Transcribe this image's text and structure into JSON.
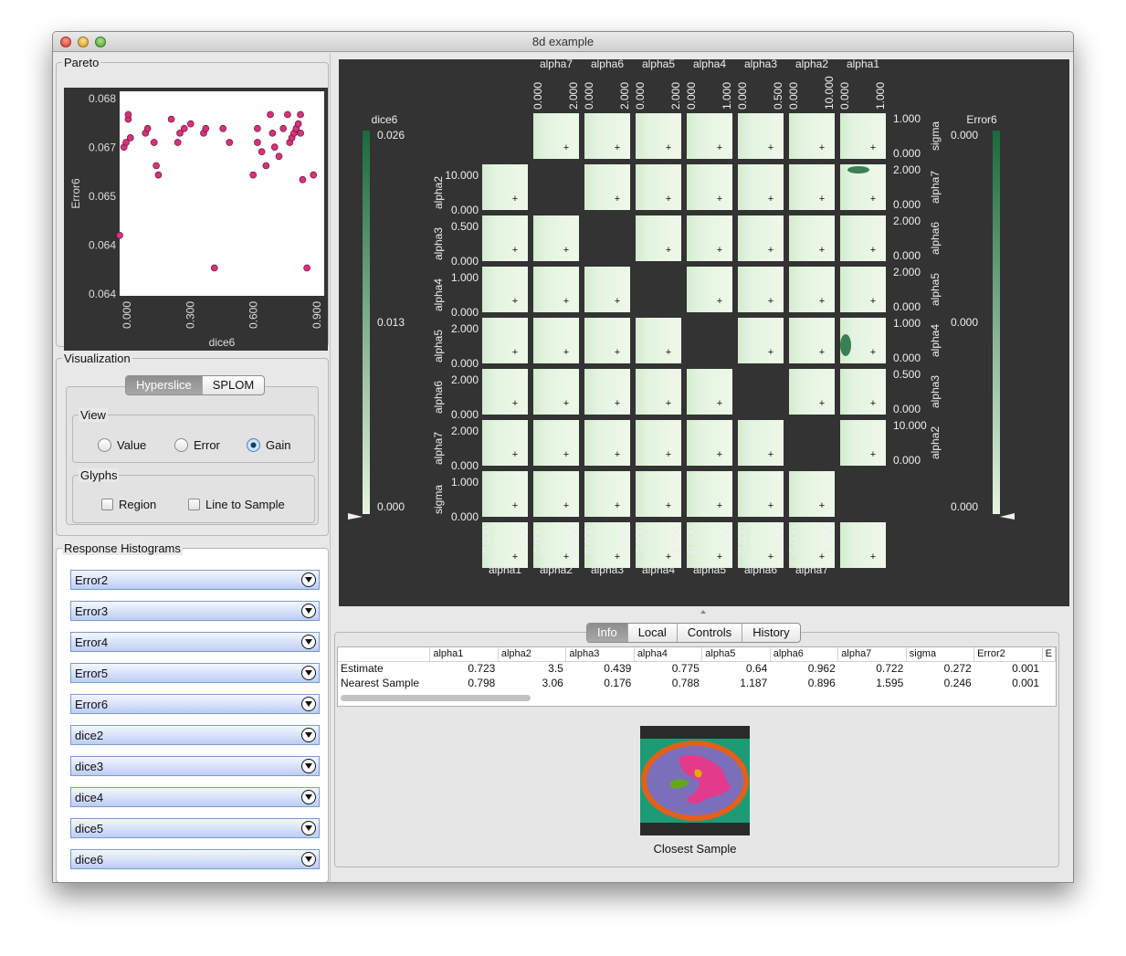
{
  "window": {
    "title": "8d example"
  },
  "pareto": {
    "title": "Pareto",
    "xlabel": "dice6",
    "ylabel": "Error6",
    "xticks": [
      "0.000",
      "0.300",
      "0.600",
      "0.900"
    ],
    "yticks": [
      "0.068",
      "0.067",
      "0.065",
      "0.064",
      "0.064"
    ],
    "point_color": "#d6337a",
    "xlim": [
      0.0,
      0.95
    ],
    "ylim": [
      0.0637,
      0.0681
    ],
    "points": [
      [
        0.0,
        0.065
      ],
      [
        0.02,
        0.0669
      ],
      [
        0.03,
        0.067
      ],
      [
        0.04,
        0.0675
      ],
      [
        0.04,
        0.0676
      ],
      [
        0.05,
        0.0671
      ],
      [
        0.12,
        0.0672
      ],
      [
        0.13,
        0.0673
      ],
      [
        0.16,
        0.067
      ],
      [
        0.17,
        0.0665
      ],
      [
        0.18,
        0.0663
      ],
      [
        0.24,
        0.0675
      ],
      [
        0.27,
        0.067
      ],
      [
        0.28,
        0.0672
      ],
      [
        0.3,
        0.0673
      ],
      [
        0.33,
        0.0674
      ],
      [
        0.39,
        0.0672
      ],
      [
        0.4,
        0.0673
      ],
      [
        0.44,
        0.0643
      ],
      [
        0.48,
        0.0673
      ],
      [
        0.51,
        0.067
      ],
      [
        0.62,
        0.0663
      ],
      [
        0.64,
        0.0673
      ],
      [
        0.64,
        0.067
      ],
      [
        0.66,
        0.0668
      ],
      [
        0.68,
        0.0665
      ],
      [
        0.7,
        0.0676
      ],
      [
        0.71,
        0.0672
      ],
      [
        0.72,
        0.0669
      ],
      [
        0.74,
        0.0667
      ],
      [
        0.76,
        0.0673
      ],
      [
        0.78,
        0.0676
      ],
      [
        0.79,
        0.067
      ],
      [
        0.8,
        0.0671
      ],
      [
        0.81,
        0.0672
      ],
      [
        0.82,
        0.0673
      ],
      [
        0.83,
        0.0674
      ],
      [
        0.84,
        0.0676
      ],
      [
        0.84,
        0.0672
      ],
      [
        0.85,
        0.0662
      ],
      [
        0.87,
        0.0643
      ],
      [
        0.9,
        0.0663
      ]
    ]
  },
  "visualization": {
    "title": "Visualization",
    "mode_tabs": [
      "Hyperslice",
      "SPLOM"
    ],
    "active_mode": "Hyperslice",
    "view": {
      "title": "View",
      "options": [
        "Value",
        "Error",
        "Gain"
      ],
      "selected": "Gain"
    },
    "glyphs": {
      "title": "Glyphs",
      "options": [
        "Region",
        "Line to Sample"
      ]
    }
  },
  "histograms": {
    "title": "Response Histograms",
    "items": [
      "Error2",
      "Error3",
      "Error4",
      "Error5",
      "Error6",
      "dice2",
      "dice3",
      "dice4",
      "dice5",
      "dice6"
    ]
  },
  "matrix": {
    "lower_dims": [
      "alpha2",
      "alpha3",
      "alpha4",
      "alpha5",
      "alpha6",
      "alpha7",
      "sigma"
    ],
    "upper_dims": [
      "sigma",
      "alpha7",
      "alpha6",
      "alpha5",
      "alpha4",
      "alpha3",
      "alpha2"
    ],
    "bottom_dims": [
      "alpha1",
      "alpha2",
      "alpha3",
      "alpha4",
      "alpha5",
      "alpha6",
      "alpha7"
    ],
    "top_dims": [
      "alpha7",
      "alpha6",
      "alpha5",
      "alpha4",
      "alpha3",
      "alpha2",
      "alpha1"
    ],
    "ranges": {
      "alpha1": "1.000",
      "alpha2": "10.000",
      "alpha3": "0.500",
      "alpha4": "1.000",
      "alpha5": "2.000",
      "alpha6": "2.000",
      "alpha7": "2.000",
      "sigma": "1.000"
    },
    "zero": "0.000",
    "left_colorbar": {
      "label": "dice6",
      "max": "0.026",
      "mid": "0.013",
      "min": "0.000",
      "color": "#1a6a3c"
    },
    "right_colorbar": {
      "label": "Error6",
      "max": "0.000",
      "mid": "0.000",
      "min": "0.000",
      "color": "#1a6a3c"
    },
    "cell_color": "#e4f4e0",
    "dark_cell_color": "#1d6b3d"
  },
  "info": {
    "tabs": [
      "Info",
      "Local",
      "Controls",
      "History"
    ],
    "active_tab": "Info",
    "columns": [
      "",
      "alpha1",
      "alpha2",
      "alpha3",
      "alpha4",
      "alpha5",
      "alpha6",
      "alpha7",
      "sigma",
      "Error2",
      "E"
    ],
    "rows": [
      [
        "Estimate",
        "0.723",
        "3.5",
        "0.439",
        "0.775",
        "0.64",
        "0.962",
        "0.722",
        "0.272",
        "0.001"
      ],
      [
        "Nearest Sample",
        "0.798",
        "3.06",
        "0.176",
        "0.788",
        "1.187",
        "0.896",
        "1.595",
        "0.246",
        "0.001"
      ]
    ],
    "sample_caption": "Closest Sample"
  }
}
